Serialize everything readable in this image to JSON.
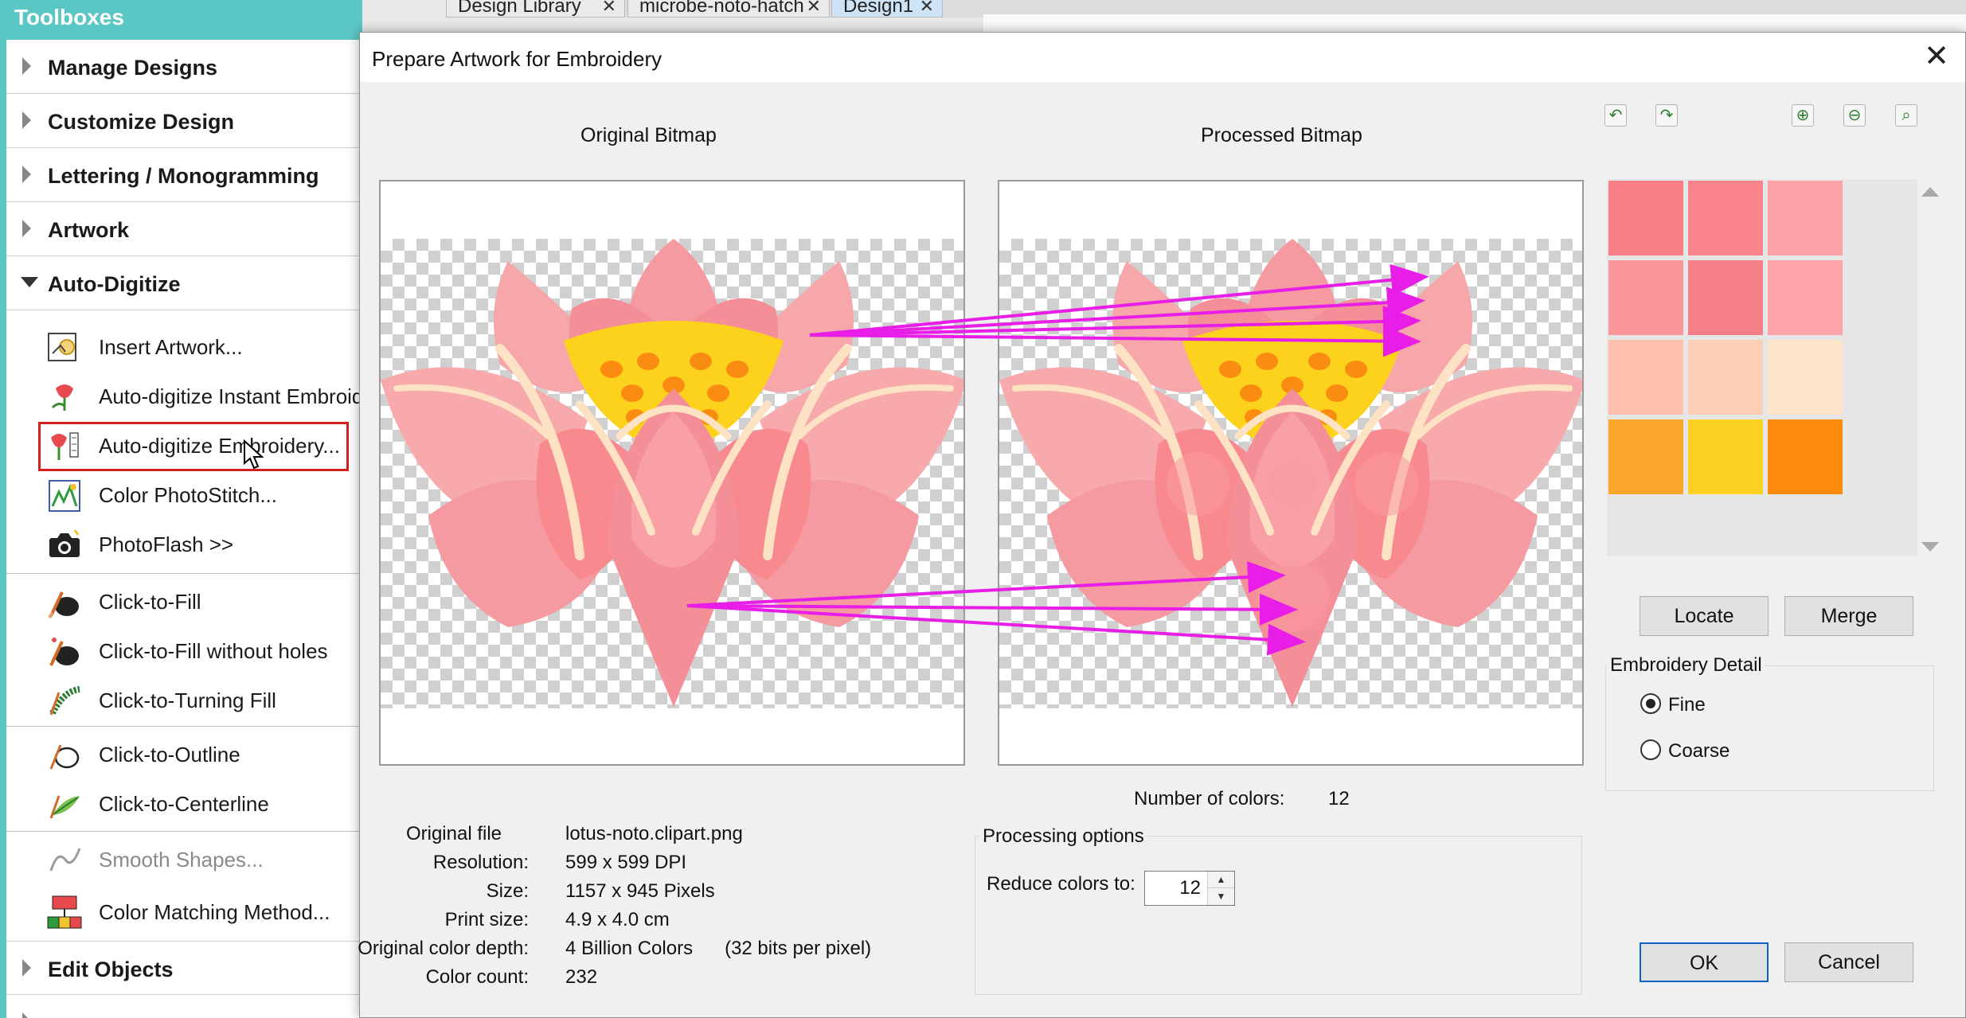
{
  "sidebar": {
    "title": "Toolboxes",
    "sections": [
      {
        "label": "Manage Designs"
      },
      {
        "label": "Customize Design"
      },
      {
        "label": "Lettering / Monogramming"
      },
      {
        "label": "Artwork"
      },
      {
        "label": "Auto-Digitize"
      }
    ],
    "items": [
      {
        "label": "Insert Artwork...",
        "icon": "insert-artwork-icon"
      },
      {
        "label": "Auto-digitize Instant Embroidery",
        "icon": "instant-embroidery-icon"
      },
      {
        "label": "Auto-digitize Embroidery...",
        "icon": "auto-digitize-embroidery-icon"
      },
      {
        "label": "Color PhotoStitch...",
        "icon": "photostitch-icon"
      },
      {
        "label": "PhotoFlash >>",
        "icon": "camera-icon"
      },
      {
        "label": "Click-to-Fill",
        "icon": "click-fill-icon"
      },
      {
        "label": "Click-to-Fill without holes",
        "icon": "click-fill-no-holes-icon"
      },
      {
        "label": "Click-to-Turning Fill",
        "icon": "turning-fill-icon"
      },
      {
        "label": "Click-to-Outline",
        "icon": "outline-icon"
      },
      {
        "label": "Click-to-Centerline",
        "icon": "centerline-icon"
      },
      {
        "label": "Smooth Shapes...",
        "icon": "smooth-shapes-icon"
      },
      {
        "label": "Color Matching Method...",
        "icon": "color-matching-icon"
      }
    ],
    "bottom_sections": [
      {
        "label": "Edit Objects"
      }
    ]
  },
  "tabs": [
    {
      "label": "Design Library"
    },
    {
      "label": "microbe-noto-hatch"
    },
    {
      "label": "Design1"
    }
  ],
  "dialog": {
    "title": "Prepare Artwork for Embroidery",
    "original_title": "Original Bitmap",
    "processed_title": "Processed Bitmap",
    "num_colors_label": "Number of colors:",
    "num_colors_value": "12",
    "info": [
      {
        "label": "Original file",
        "value": "lotus-noto.clipart.png"
      },
      {
        "label": "Resolution:",
        "value": "599 x 599 DPI"
      },
      {
        "label": "Size:",
        "value": "1157 x 945 Pixels"
      },
      {
        "label": "Print size:",
        "value": "4.9 x 4.0 cm"
      },
      {
        "label": "Original color depth:",
        "value": "4 Billion Colors      (32 bits per pixel)"
      },
      {
        "label": "Color count:",
        "value": "232"
      }
    ],
    "processing": {
      "title": "Processing options",
      "reduce_label": "Reduce colors to:",
      "reduce_value": "12"
    },
    "palette_colors": [
      "#fa7e86",
      "#f9868f",
      "#fca1a5",
      "#fa969b",
      "#f47f89",
      "#fca4a8",
      "#fdbfae",
      "#fccfb5",
      "#fde4cb",
      "#fca52b",
      "#fbd223",
      "#fd8c0e"
    ],
    "buttons": {
      "locate": "Locate",
      "merge": "Merge",
      "ok": "OK",
      "cancel": "Cancel"
    },
    "detail": {
      "title": "Embroidery Detail",
      "fine": "Fine",
      "coarse": "Coarse",
      "selected": "Fine"
    },
    "toolbar": [
      "undo-icon",
      "redo-icon",
      "zoom-in-icon",
      "zoom-out-icon",
      "zoom-fit-icon"
    ]
  },
  "colors": {
    "teal": "#5bc7c4",
    "highlight": "#d21f1f",
    "arrow": "#e81ee8"
  }
}
